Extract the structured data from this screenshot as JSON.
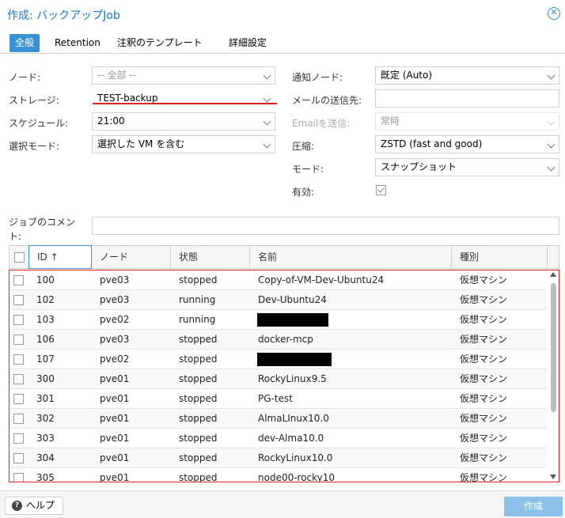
{
  "window": {
    "title": "作成: バックアップJob"
  },
  "tabs": [
    {
      "label": "全般",
      "active": true
    },
    {
      "label": "Retention"
    },
    {
      "label": "注釈のテンプレート"
    },
    {
      "label": "詳細設定"
    }
  ],
  "form": {
    "node": {
      "label": "ノード:",
      "value": "-- 全部 --"
    },
    "storage": {
      "label": "ストレージ:",
      "value": "TEST-backup"
    },
    "schedule": {
      "label": "スケジュール:",
      "value": "21:00"
    },
    "selection_mode": {
      "label": "選択モード:",
      "value": "選択した VM を含む"
    },
    "notify_node": {
      "label": "通知ノード:",
      "value": "既定 (Auto)"
    },
    "mail_to": {
      "label": "メールの送信先:",
      "value": ""
    },
    "email": {
      "label": "Emailを送信:",
      "value": "常時"
    },
    "compression": {
      "label": "圧縮:",
      "value": "ZSTD (fast and good)"
    },
    "mode": {
      "label": "モード:",
      "value": "スナップショット"
    },
    "enabled": {
      "label": "有効:",
      "checked": true
    },
    "comment": {
      "label_line1": "ジョブのコメン",
      "label_line2": "ト:",
      "value": ""
    }
  },
  "table": {
    "columns": [
      "ID ↑",
      "ノード",
      "状態",
      "名前",
      "種別"
    ],
    "rows": [
      {
        "id": "100",
        "node": "pve03",
        "status": "stopped",
        "name": "Copy-of-VM-Dev-Ubuntu24",
        "type": "仮想マシン"
      },
      {
        "id": "102",
        "node": "pve03",
        "status": "running",
        "name": "Dev-Ubuntu24",
        "type": "仮想マシン"
      },
      {
        "id": "103",
        "node": "pve02",
        "status": "running",
        "name": "",
        "type": "仮想マシン",
        "redacted": true
      },
      {
        "id": "106",
        "node": "pve03",
        "status": "stopped",
        "name": "docker-mcp",
        "type": "仮想マシン"
      },
      {
        "id": "107",
        "node": "pve02",
        "status": "stopped",
        "name": "",
        "type": "仮想マシン",
        "redacted": true
      },
      {
        "id": "300",
        "node": "pve01",
        "status": "stopped",
        "name": "RockyLinux9.5",
        "type": "仮想マシン"
      },
      {
        "id": "301",
        "node": "pve01",
        "status": "stopped",
        "name": "PG-test",
        "type": "仮想マシン"
      },
      {
        "id": "302",
        "node": "pve01",
        "status": "stopped",
        "name": "AlmaLInux10.0",
        "type": "仮想マシン"
      },
      {
        "id": "303",
        "node": "pve01",
        "status": "stopped",
        "name": "dev-Alma10.0",
        "type": "仮想マシン"
      },
      {
        "id": "304",
        "node": "pve01",
        "status": "stopped",
        "name": "RockyLinux10.0",
        "type": "仮想マシン"
      },
      {
        "id": "305",
        "node": "pve01",
        "status": "stopped",
        "name": "node00-rocky10",
        "type": "仮想マシン"
      }
    ]
  },
  "footer": {
    "help_label": "ヘルプ",
    "create_label": "作成"
  },
  "colors": {
    "accent": "#3892d4",
    "highlight_red": "#d81e1e",
    "disabled_button": "#8cc2ea"
  }
}
